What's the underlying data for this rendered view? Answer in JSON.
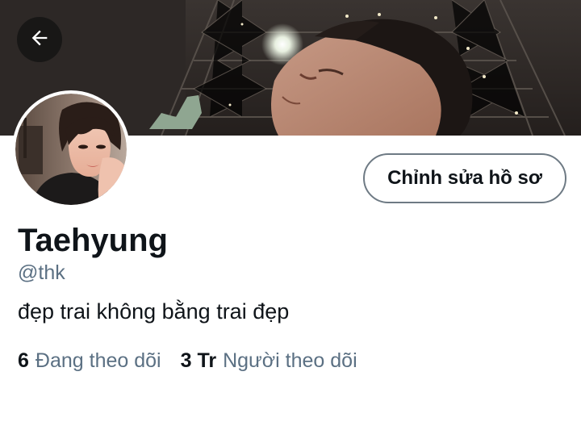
{
  "header": {
    "back_icon": "arrow-left-icon"
  },
  "profile": {
    "edit_button_label": "Chỉnh sửa hồ sơ",
    "display_name": "Taehyung",
    "handle": "@thk",
    "bio": "đẹp trai không bằng trai đẹp",
    "following_count": "6",
    "following_label": "Đang theo dõi",
    "followers_count": "3 Tr",
    "followers_label": "Người theo dõi"
  },
  "colors": {
    "text_primary": "#0f1419",
    "text_secondary": "#5b7083",
    "button_border": "#6e7a84"
  }
}
